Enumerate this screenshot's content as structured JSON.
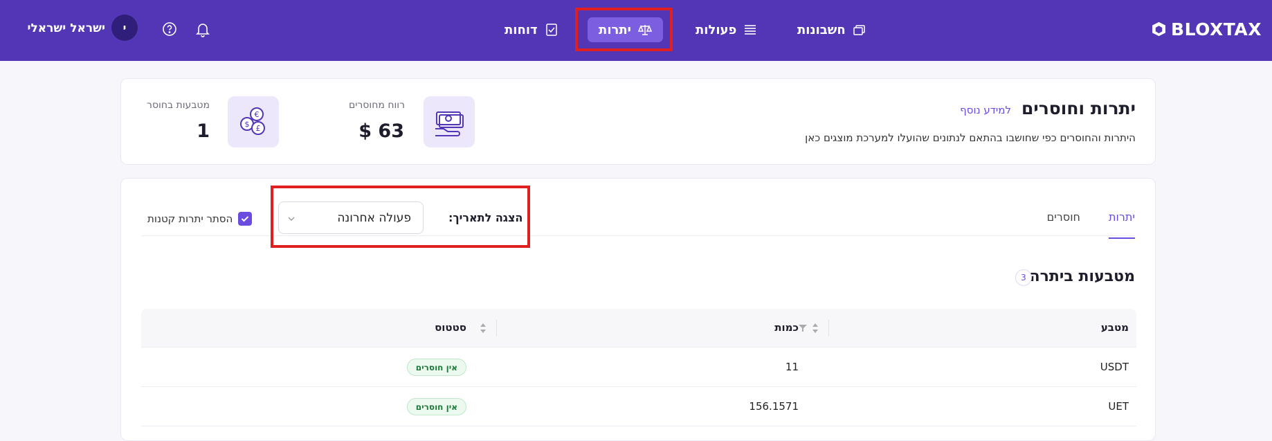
{
  "app": {
    "logo_text": "BLOXTAX",
    "nav": {
      "accounts": "חשבונות",
      "actions": "פעולות",
      "balances": "יתרות",
      "reports": "דוחות"
    },
    "user": {
      "avatar_initial": "י",
      "name": "ישראל ישראלי"
    }
  },
  "summary": {
    "title": "יתרות וחוסרים",
    "learn_more": "למידע נוסף",
    "subtitle": "היתרות והחוסרים כפי שחושבו בהתאם לנתונים שהועלו למערכת מוצגים כאן",
    "profit_label": "רווח מחוסרים",
    "profit_value": "$ 63",
    "missing_label": "מטבעות בחוסר",
    "missing_value": "1"
  },
  "main": {
    "tabs": {
      "balances": "יתרות",
      "missing": "חוסרים"
    },
    "date_label": "הצגה לתאריך:",
    "date_value": "פעולה אחרונה",
    "hide_small_label": "הסתר יתרות קטנות",
    "hide_small_checked": true,
    "section_title": "מטבעות ביתרה",
    "section_count": "3",
    "table": {
      "headers": {
        "coin": "מטבע",
        "amount": "כמות",
        "status": "סטטוס"
      },
      "rows": [
        {
          "coin": "USDT",
          "amount": "11",
          "status": "אין חוסרים"
        },
        {
          "coin": "UET",
          "amount": "156.1571",
          "status": "אין חוסרים"
        }
      ]
    }
  },
  "colors": {
    "nav_bg": "#5236b5",
    "accent": "#6a4ce0",
    "active_nav": "#7b5fe0",
    "highlight": "#e02020",
    "status_green": "#1d7a3a"
  }
}
